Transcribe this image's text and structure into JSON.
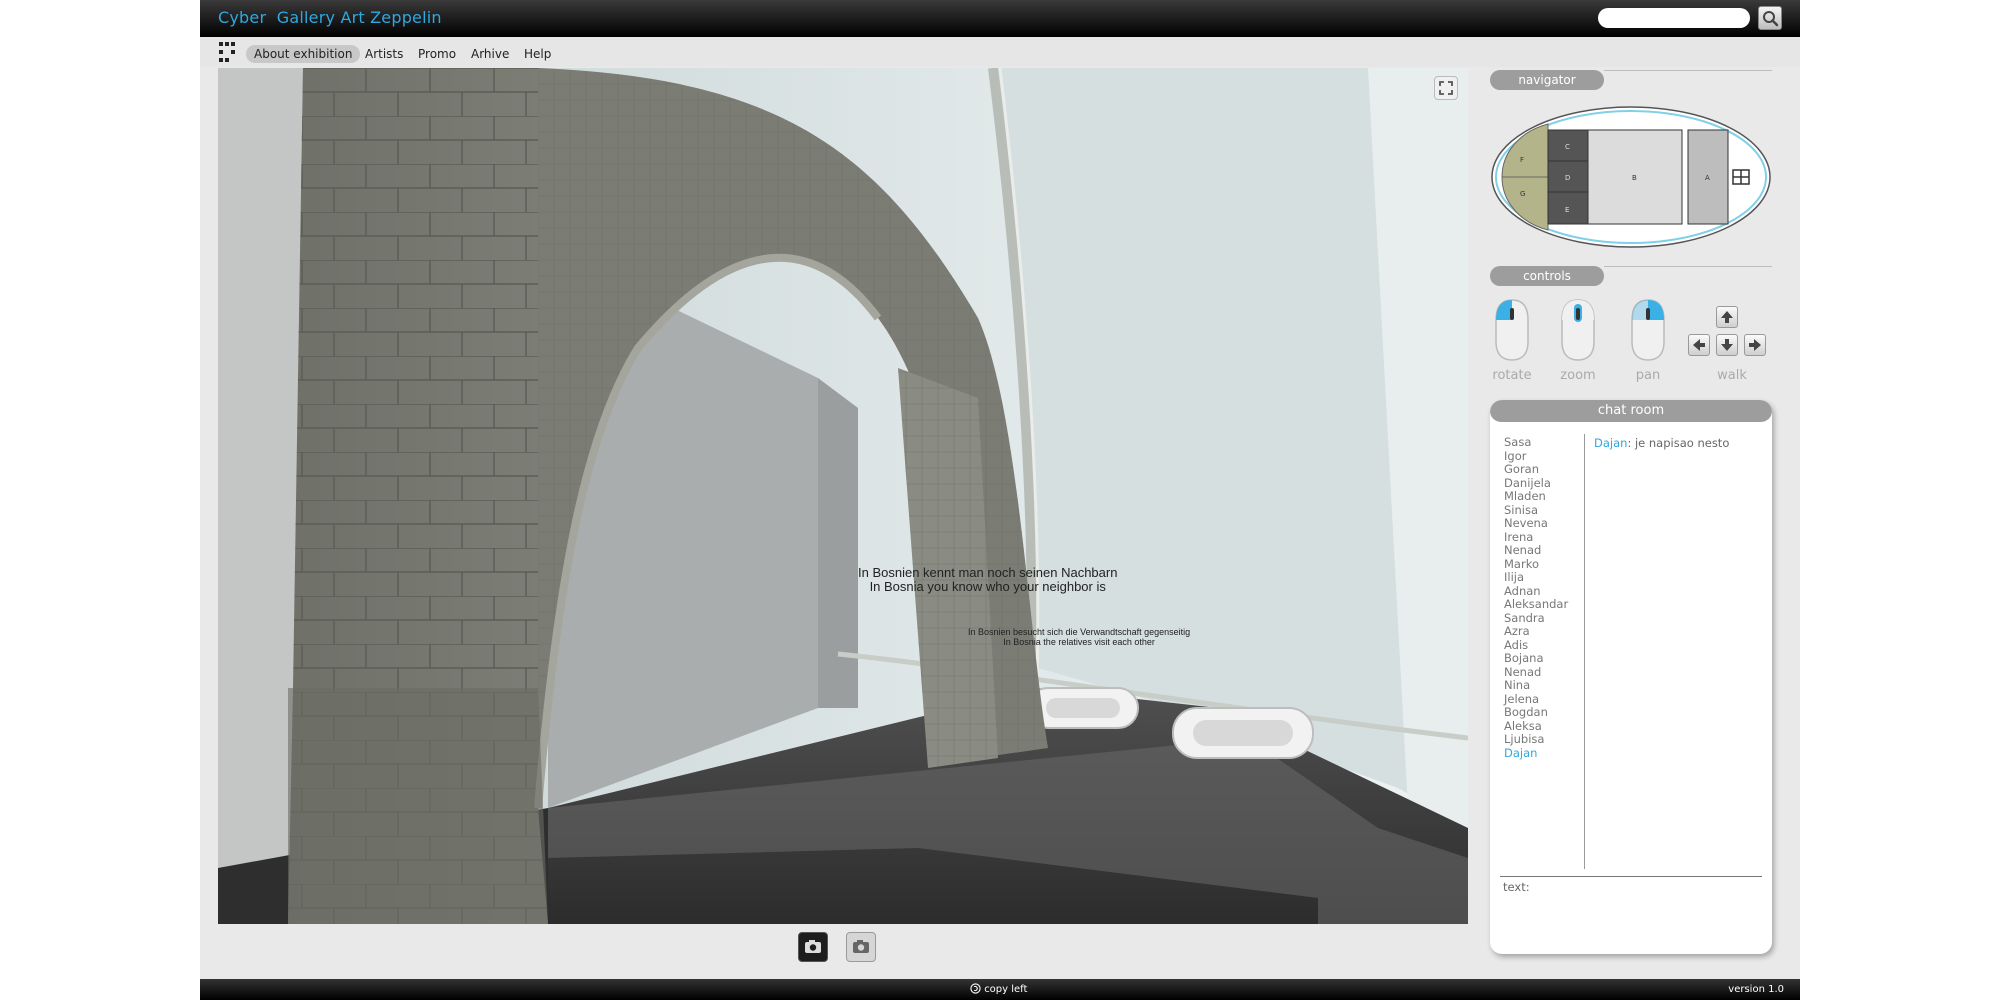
{
  "header": {
    "title": "Cyber  Gallery Art Zeppelin",
    "search_placeholder": "",
    "search_icon": "magnifier-icon"
  },
  "menu": {
    "logo_icon": "grid-logo-icon",
    "items": [
      {
        "label": "About exhibition",
        "active": true
      },
      {
        "label": "Artists",
        "active": false
      },
      {
        "label": "Promo",
        "active": false
      },
      {
        "label": "Arhive",
        "active": false
      },
      {
        "label": "Help",
        "active": false
      }
    ]
  },
  "viewport": {
    "wall_text_1_line1": "In Bosnien kennt man noch seinen Nachbarn",
    "wall_text_1_line2": "In Bosnia you know who your neighbor is",
    "wall_text_2_line1": "In Bosnien besucht sich die Verwandtschaft gegenseitig",
    "wall_text_2_line2": "In Bosnia the relatives visit each other",
    "fullscreen_icon": "fullscreen-icon"
  },
  "camera_buttons": [
    {
      "icon": "camera-icon",
      "state": "active"
    },
    {
      "icon": "camera-icon",
      "state": "inactive"
    }
  ],
  "navigator": {
    "title": "navigator",
    "zones": [
      "F",
      "G",
      "C",
      "D",
      "E",
      "B",
      "A"
    ],
    "entrance_icon": "stairs-icon"
  },
  "controls": {
    "title": "controls",
    "rotate": "rotate",
    "zoom": "zoom",
    "pan": "pan",
    "walk": "walk"
  },
  "chat": {
    "title": "chat room",
    "users": [
      "Sasa",
      "Igor",
      "Goran",
      "Danijela",
      "Mladen",
      "Sinisa",
      "Nevena",
      "Irena",
      "Nenad",
      "Marko",
      "Ilija",
      "Adnan",
      "Aleksandar",
      "Sandra",
      "Azra",
      "Adis",
      "Bojana",
      "Nenad",
      "Nina",
      "Jelena",
      "Bogdan",
      "Aleksa",
      "Ljubisa",
      "Dajan"
    ],
    "highlighted_user": "Dajan",
    "message_author": "Dajan",
    "message_text": ": je napisao nesto",
    "text_label": "text:"
  },
  "footer": {
    "copyleft_icon": "copyleft-icon",
    "copyleft": "copy left",
    "version": "version 1.0"
  },
  "colors": {
    "accent": "#2fa8e0",
    "header_bg": "#000000",
    "panel_header": "#9d9d9d",
    "app_bg": "#e9e9e9"
  }
}
